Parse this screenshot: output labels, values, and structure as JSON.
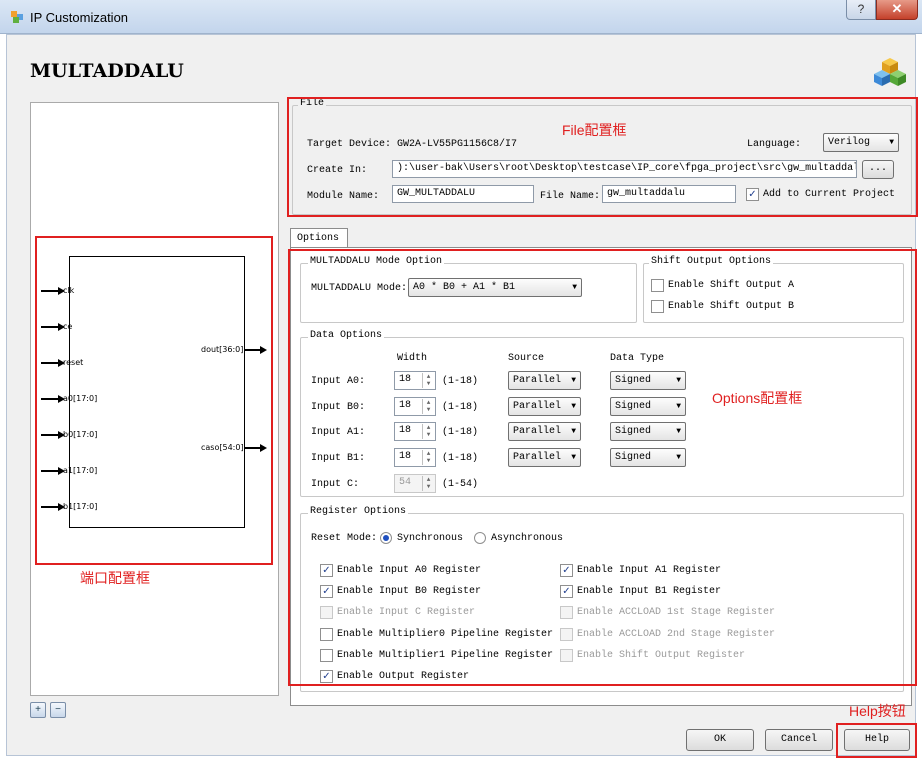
{
  "window": {
    "title": "IP Customization",
    "help_glyph": "?",
    "close_glyph": "✕"
  },
  "header": {
    "title": "MULTADDALU"
  },
  "ports": {
    "inputs": [
      "clk",
      "ce",
      "reset",
      "a0[17:0]",
      "b0[17:0]",
      "a1[17:0]",
      "b1[17:0]"
    ],
    "outputs": [
      "dout[36:0]",
      "caso[54:0]"
    ]
  },
  "annotations": {
    "file_box": "File配置框",
    "options_box": "Options配置框",
    "port_box": "端口配置框",
    "help_button": "Help按钮"
  },
  "file": {
    "title": "File",
    "target_label": "Target Device:",
    "target_value": "GW2A-LV55PG1156C8/I7",
    "language_label": "Language:",
    "language_value": "Verilog",
    "create_label": "Create In:",
    "create_value": "):\\user-bak\\Users\\root\\Desktop\\testcase\\IP_core\\fpga_project\\src\\gw_multaddalu",
    "browse_label": "...",
    "module_label": "Module Name:",
    "module_value": "GW_MULTADDALU",
    "filename_label": "File Name:",
    "filename_value": "gw_multaddalu",
    "add_label": "Add to Current Project"
  },
  "options": {
    "tab_label": "Options",
    "mode_group": "MULTADDALU Mode Option",
    "mode_label": "MULTADDALU Mode:",
    "mode_value": "A0 * B0 + A1 * B1",
    "shift_group": "Shift Output Options",
    "shift_a": "Enable Shift Output A",
    "shift_b": "Enable Shift Output B",
    "data_group": "Data Options",
    "col_width": "Width",
    "col_source": "Source",
    "col_type": "Data Type",
    "rows": [
      {
        "label": "Input A0:",
        "width": "18",
        "range": "(1-18)",
        "source": "Parallel",
        "type": "Signed"
      },
      {
        "label": "Input B0:",
        "width": "18",
        "range": "(1-18)",
        "source": "Parallel",
        "type": "Signed"
      },
      {
        "label": "Input A1:",
        "width": "18",
        "range": "(1-18)",
        "source": "Parallel",
        "type": "Signed"
      },
      {
        "label": "Input B1:",
        "width": "18",
        "range": "(1-18)",
        "source": "Parallel",
        "type": "Signed"
      },
      {
        "label": "Input C:",
        "width": "54",
        "range": "(1-54)",
        "source": "",
        "type": ""
      }
    ],
    "register_group": "Register Options",
    "reset_label": "Reset Mode:",
    "reset_sync": "Synchronous",
    "reset_async": "Asynchronous",
    "reg_left": [
      {
        "label": "Enable Input A0 Register",
        "checked": true,
        "disabled": false
      },
      {
        "label": "Enable Input B0 Register",
        "checked": true,
        "disabled": false
      },
      {
        "label": "Enable Input C Register",
        "checked": false,
        "disabled": true
      },
      {
        "label": "Enable Multiplier0 Pipeline Register",
        "checked": false,
        "disabled": false
      },
      {
        "label": "Enable Multiplier1 Pipeline Register",
        "checked": false,
        "disabled": false
      },
      {
        "label": "Enable Output Register",
        "checked": true,
        "disabled": false
      }
    ],
    "reg_right": [
      {
        "label": "Enable Input A1 Register",
        "checked": true,
        "disabled": false
      },
      {
        "label": "Enable Input B1 Register",
        "checked": true,
        "disabled": false
      },
      {
        "label": "Enable ACCLOAD 1st Stage Register",
        "checked": false,
        "disabled": true
      },
      {
        "label": "Enable ACCLOAD 2nd Stage Register",
        "checked": false,
        "disabled": true
      },
      {
        "label": "Enable Shift Output Register",
        "checked": false,
        "disabled": true
      }
    ]
  },
  "footer": {
    "ok": "OK",
    "cancel": "Cancel",
    "help": "Help"
  },
  "colors": {
    "annotation": "#e02020",
    "check": "#23408e"
  }
}
